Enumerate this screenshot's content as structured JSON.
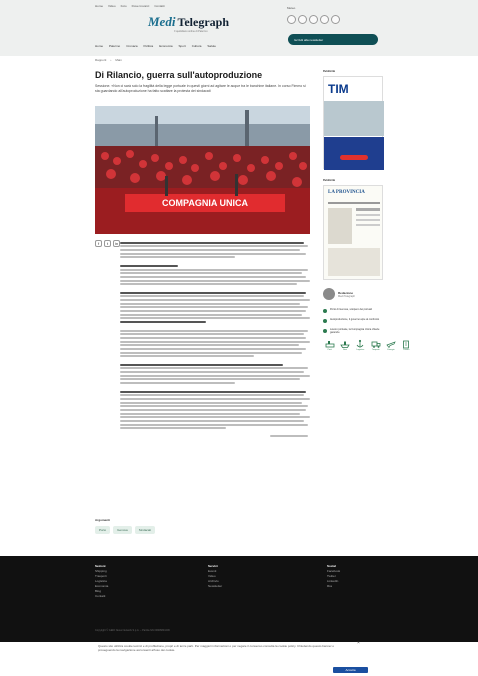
{
  "header": {
    "top_links": [
      "Home",
      "Video",
      "Foto",
      "Dove trovarci",
      "Contatti"
    ],
    "logo_m": "Medi",
    "logo_t": "Telegraph",
    "tagline": "Il quotidiano online di Palermo",
    "weather_label": "Meteo",
    "newsletter_label": "Iscriviti alla newsletter",
    "nav": [
      "Home",
      "Palermo",
      "Cronaca",
      "Politica",
      "Economia",
      "Sport",
      "Cultura",
      "Salute"
    ]
  },
  "breadcrumb": [
    "Rapporti",
    "Main"
  ],
  "article": {
    "title": "Di Rilancio, guerra sull'autoproduzione",
    "subtitle": "Sessione. «Non ci sarà solo la fragilità della legge portuale in questi giorni ad agitare le acque tra le banchine italiane. In corso Fimmo si sta guardando all'autoproduzione ha fatto scattare la protesta dei sindacati",
    "hero_banner_text": "COMPAGNIA UNICA",
    "social": [
      "f",
      "t",
      "in"
    ]
  },
  "tags_heading": "Argomenti",
  "tags": [
    "Porto",
    "Genova",
    "Sindacati"
  ],
  "sidebar": {
    "ad1_heading": "Pubblicità",
    "ad1_brand": "TIM",
    "ad2_heading": "Pubblicità",
    "ad2_title": "LA PROVINCIA",
    "author_name": "Redazione",
    "author_role": "Medi Telegraph",
    "related": [
      "Porto di Genova, sciopero dei portuali",
      "Autoproduzione, il governo apre al confronto",
      "Lavoro portuale, la Compagnia Unica chiede garanzie"
    ],
    "icons": [
      {
        "name": "Porti",
        "icon": "port-icon"
      },
      {
        "name": "Navi",
        "icon": "ship-icon"
      },
      {
        "name": "Logistica",
        "icon": "anchor-icon"
      },
      {
        "name": "Trasporti",
        "icon": "truck-icon"
      },
      {
        "name": "Energia",
        "icon": "plane-icon"
      },
      {
        "name": "Lavoro",
        "icon": "building-icon"
      }
    ]
  },
  "footer": {
    "col1_title": "Sezioni",
    "col1": [
      "Shipping",
      "Trasporti",
      "Logistica",
      "Economia",
      "Blog",
      "Contatti"
    ],
    "col2_title": "Servizi",
    "col2": [
      "Eventi",
      "Video",
      "Archivio",
      "Newsletter"
    ],
    "col3_title": "Social",
    "col3": [
      "Facebook",
      "Twitter",
      "LinkedIn",
      "Rss"
    ],
    "copyright": "Copyright © GEDI News Network S.p.A. – Partita IVA 00906801006"
  },
  "cookie": {
    "text": "Questo sito utilizza cookie tecnici e di profilazione, propri e di terze parti. Per maggiori informazioni o per negare il consenso consulta la cookie policy. Chiudendo questo banner o proseguendo la navigazione acconsenti all'uso dei cookie.",
    "accept_label": "Accetta",
    "close": "×"
  },
  "colors": {
    "teal": "#0f4f55",
    "green": "#2c7a4f",
    "footer": "#111111",
    "hero_red": "#c8262a"
  }
}
